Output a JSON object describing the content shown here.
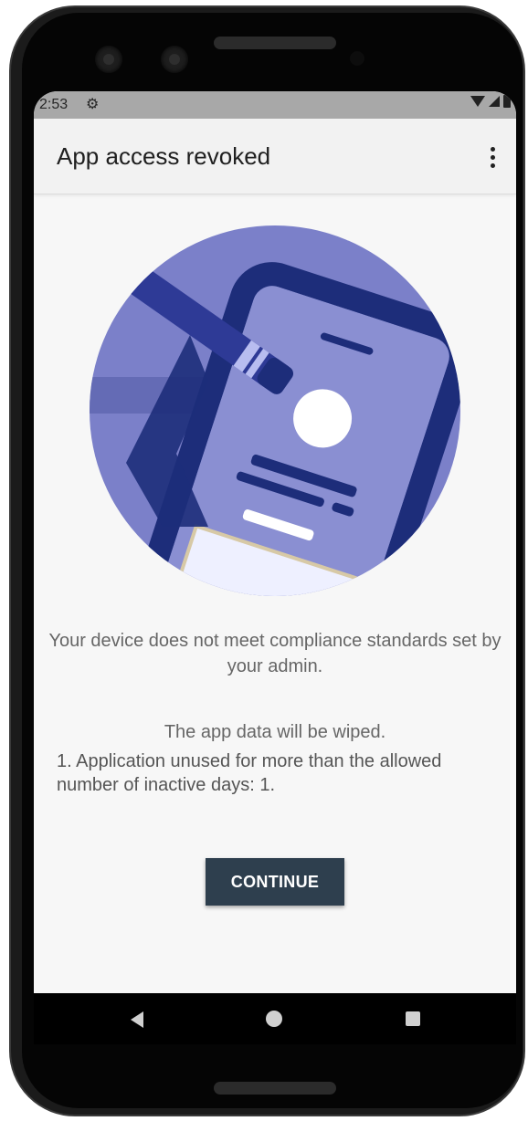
{
  "status_bar": {
    "time": "2:53",
    "icons": [
      "gear-icon",
      "wifi-icon",
      "signal-icon",
      "battery-icon"
    ]
  },
  "app_bar": {
    "title": "App access revoked",
    "menu_icon": "more-vert-icon"
  },
  "content": {
    "message": "Your device does not meet compliance standards set by your admin.",
    "wipe_notice": "The app data will be wiped.",
    "reason": "1. Application unused for more than the allowed number of inactive days: 1."
  },
  "actions": {
    "continue_label": "CONTINUE"
  },
  "colors": {
    "illustration_bg": "#7b80c9",
    "illustration_dark": "#1d2d7a",
    "button_bg": "#2e3f4e"
  },
  "nav_bar": {
    "icons": [
      "back-icon",
      "home-icon",
      "recents-icon"
    ]
  }
}
